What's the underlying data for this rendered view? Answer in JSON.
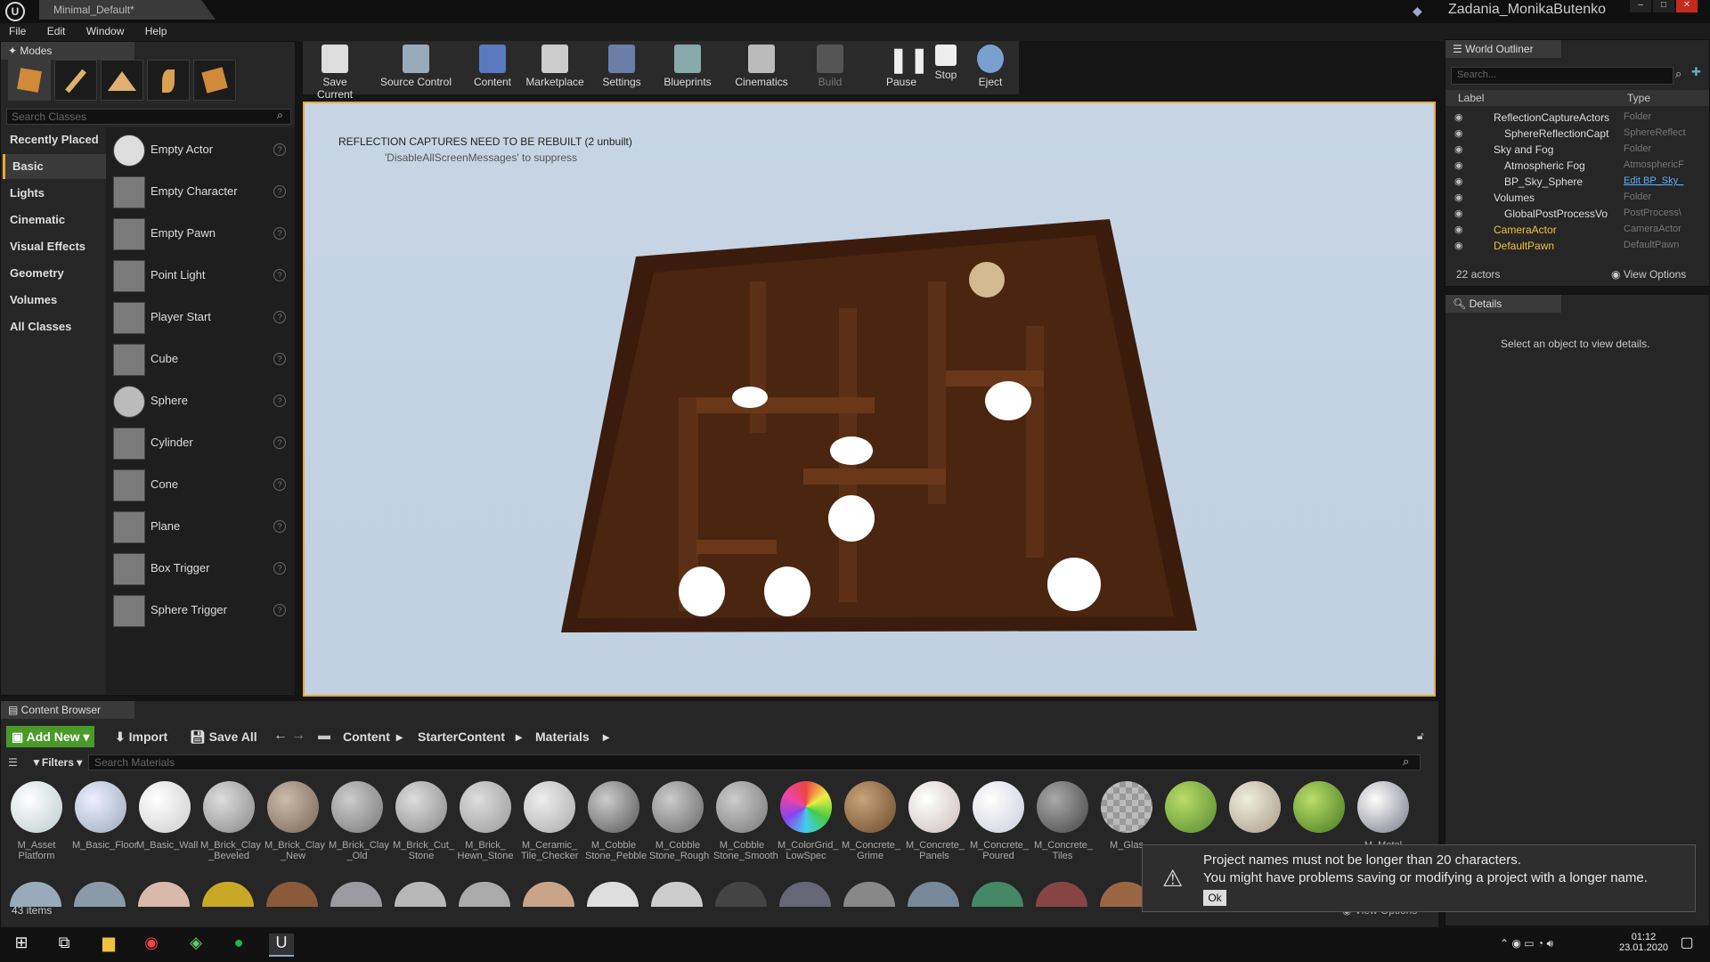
{
  "window": {
    "tab_title": "Minimal_Default*",
    "project_name": "Zadania_MonikaButenko"
  },
  "menu": [
    "File",
    "Edit",
    "Window",
    "Help"
  ],
  "modes": {
    "tab": "Modes",
    "search_placeholder": "Search Classes",
    "categories": [
      "Recently Placed",
      "Basic",
      "Lights",
      "Cinematic",
      "Visual Effects",
      "Geometry",
      "Volumes",
      "All Classes"
    ],
    "actors": [
      "Empty Actor",
      "Empty Character",
      "Empty Pawn",
      "Point Light",
      "Player Start",
      "Cube",
      "Sphere",
      "Cylinder",
      "Cone",
      "Plane",
      "Box Trigger",
      "Sphere Trigger"
    ]
  },
  "toolbar": [
    "Save Current",
    "Source Control",
    "Content",
    "Marketplace",
    "Settings",
    "Blueprints",
    "Cinematics",
    "Build",
    "Pause",
    "Stop",
    "Eject"
  ],
  "viewport": {
    "message": "REFLECTION CAPTURES NEED TO BE REBUILT (2 unbuilt)",
    "suppress": "'DisableAllScreenMessages' to suppress"
  },
  "outliner": {
    "tab": "World Outliner",
    "search_placeholder": "Search...",
    "col_label": "Label",
    "col_type": "Type",
    "rows": [
      {
        "label": "ReflectionCaptureActors",
        "type": "Folder"
      },
      {
        "label": "SphereReflectionCapt",
        "type": "SphereReflect"
      },
      {
        "label": "Sky and Fog",
        "type": "Folder"
      },
      {
        "label": "Atmospheric Fog",
        "type": "AtmosphericF"
      },
      {
        "label": "BP_Sky_Sphere",
        "type": "Edit BP_Sky_"
      },
      {
        "label": "Volumes",
        "type": "Folder"
      },
      {
        "label": "GlobalPostProcessVo",
        "type": "PostProcess\\"
      },
      {
        "label": "CameraActor",
        "type": "CameraActor"
      },
      {
        "label": "DefaultPawn",
        "type": "DefaultPawn"
      }
    ],
    "count": "22 actors",
    "view_options": "View Options"
  },
  "details": {
    "tab": "Details",
    "empty": "Select an object to view details."
  },
  "content_browser": {
    "tab": "Content Browser",
    "add_new": "Add New",
    "import": "Import",
    "save_all": "Save All",
    "path": [
      "Content",
      "StarterContent",
      "Materials"
    ],
    "filters": "Filters",
    "search_placeholder": "Search Materials",
    "materials": [
      "M_Asset Platform",
      "M_Basic_Floor",
      "M_Basic_Wall",
      "M_Brick_Clay _Beveled",
      "M_Brick_Clay _New",
      "M_Brick_Clay _Old",
      "M_Brick_Cut_ Stone",
      "M_Brick_ Hewn_Stone",
      "M_Ceramic_ Tile_Checker",
      "M_Cobble Stone_Pebble",
      "M_Cobble Stone_Rough",
      "M_Cobble Stone_Smooth",
      "M_ColorGrid_ LowSpec",
      "M_Concrete_ Grime",
      "M_Concrete_ Panels",
      "M_Concrete_ Poured",
      "M_Concrete_ Tiles",
      "M_Glas",
      "",
      "",
      "",
      "M_Metal"
    ],
    "item_count": "43 items",
    "view_options": "View Options"
  },
  "toast": {
    "line1": "Project names must not be longer than 20 characters.",
    "line2": "You might have problems saving or modifying a project with a longer name.",
    "ok": "Ok"
  },
  "taskbar": {
    "time": "01:12",
    "date": "23.01.2020"
  }
}
